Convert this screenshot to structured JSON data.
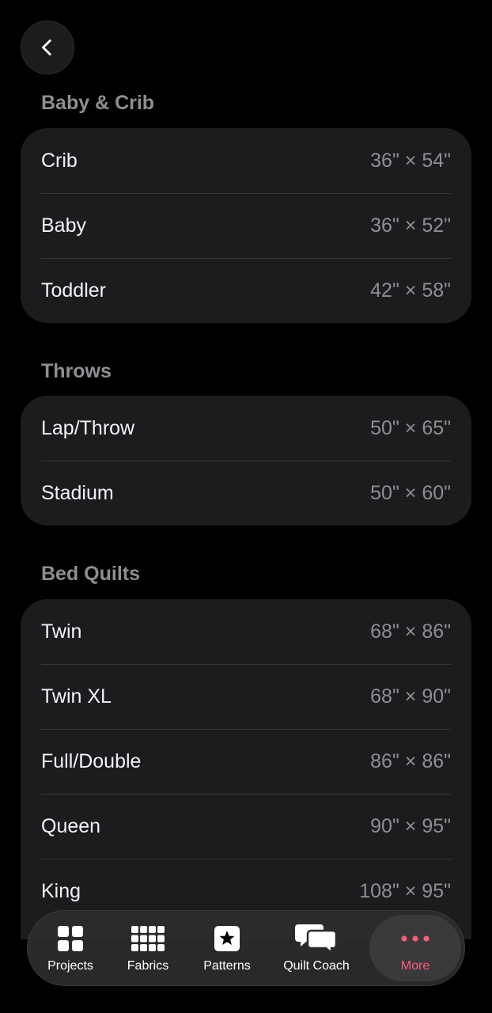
{
  "sections": [
    {
      "title": "Baby & Crib",
      "rows": [
        {
          "label": "Crib",
          "value": "36\" × 54\""
        },
        {
          "label": "Baby",
          "value": "36\" × 52\""
        },
        {
          "label": "Toddler",
          "value": "42\" × 58\""
        }
      ]
    },
    {
      "title": "Throws",
      "rows": [
        {
          "label": "Lap/Throw",
          "value": "50\" × 65\""
        },
        {
          "label": "Stadium",
          "value": "50\" × 60\""
        }
      ]
    },
    {
      "title": "Bed Quilts",
      "rows": [
        {
          "label": "Twin",
          "value": "68\" × 86\""
        },
        {
          "label": "Twin XL",
          "value": "68\" × 90\""
        },
        {
          "label": "Full/Double",
          "value": "86\" × 86\""
        },
        {
          "label": "Queen",
          "value": "90\" × 95\""
        },
        {
          "label": "King",
          "value": "108\" × 95\""
        }
      ]
    }
  ],
  "tabbar": {
    "tabs": [
      {
        "label": "Projects",
        "icon": "grid-icon"
      },
      {
        "label": "Fabrics",
        "icon": "fabric-grid-icon"
      },
      {
        "label": "Patterns",
        "icon": "star-square-icon"
      },
      {
        "label": "Quilt Coach",
        "icon": "chat-bubbles-icon"
      },
      {
        "label": "More",
        "icon": "ellipsis-icon",
        "active": true
      }
    ]
  },
  "colors": {
    "accent": "#ff5a7a",
    "card": "#1c1c1e",
    "secondary_text": "#8e8e93"
  }
}
